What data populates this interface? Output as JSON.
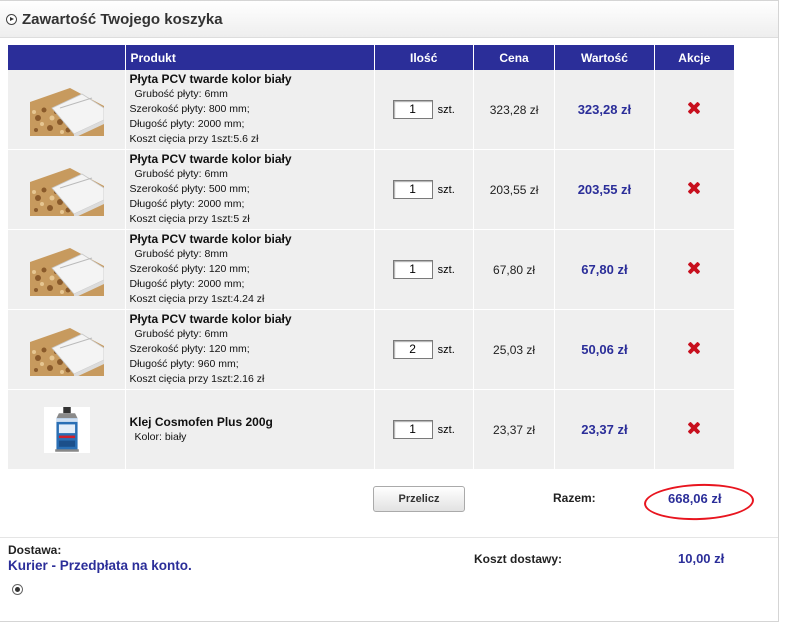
{
  "header": {
    "title": "Zawartość Twojego koszyka"
  },
  "table": {
    "columns": [
      "",
      "Produkt",
      "Ilość",
      "Cena",
      "Wartość",
      "Akcje"
    ],
    "rows": [
      {
        "name": "Płyta PCV twarde kolor biały",
        "attrs": [
          "Grubość płyty: 6mm",
          "Szerokość płyty: 800 mm;",
          "Długość płyty: 2000 mm;",
          "Koszt cięcia przy 1szt:5.6 zł"
        ],
        "qty": "1",
        "unit": "szt.",
        "price": "323,28 zł",
        "value": "323,28 zł",
        "image": "pvc-board-icon"
      },
      {
        "name": "Płyta PCV twarde kolor biały",
        "attrs": [
          "Grubość płyty: 6mm",
          "Szerokość płyty: 500 mm;",
          "Długość płyty: 2000 mm;",
          "Koszt cięcia przy 1szt:5 zł"
        ],
        "qty": "1",
        "unit": "szt.",
        "price": "203,55 zł",
        "value": "203,55 zł",
        "image": "pvc-board-icon"
      },
      {
        "name": "Płyta PCV twarde kolor biały",
        "attrs": [
          "Grubość płyty: 8mm",
          "Szerokość płyty: 120 mm;",
          "Długość płyty: 2000 mm;",
          "Koszt cięcia przy 1szt:4.24 zł"
        ],
        "qty": "1",
        "unit": "szt.",
        "price": "67,80 zł",
        "value": "67,80 zł",
        "image": "pvc-board-icon"
      },
      {
        "name": "Płyta PCV twarde kolor biały",
        "attrs": [
          "Grubość płyty: 6mm",
          "Szerokość płyty: 120 mm;",
          "Długość płyty: 960 mm;",
          "Koszt cięcia przy 1szt:2.16 zł"
        ],
        "qty": "2",
        "unit": "szt.",
        "price": "25,03 zł",
        "value": "50,06 zł",
        "image": "pvc-board-icon"
      },
      {
        "name": "Klej Cosmofen Plus 200g",
        "attrs": [
          "Kolor: biały"
        ],
        "qty": "1",
        "unit": "szt.",
        "price": "23,37 zł",
        "value": "23,37 zł",
        "image": "glue-tube-icon"
      }
    ]
  },
  "summary": {
    "recalc_label": "Przelicz",
    "total_label": "Razem:",
    "total_value": "668,06 zł"
  },
  "delivery": {
    "label": "Dostawa:",
    "method": "Kurier - Przedpłata na konto.",
    "cost_label": "Koszt dostawy:",
    "cost_value": "10,00 zł"
  },
  "colors": {
    "accent": "#2b2e99",
    "delete": "#c8101e",
    "highlight": "#e8151f"
  }
}
